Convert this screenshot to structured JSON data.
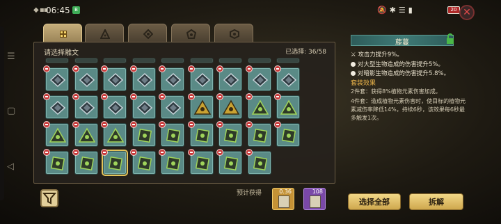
{
  "status_bar": {
    "time": "06:45",
    "app_badge": "B",
    "battery": "20"
  },
  "tabs": [
    {
      "icon": "square-rune-icon"
    },
    {
      "icon": "triangle-rune-icon"
    },
    {
      "icon": "diamond-rune-icon"
    },
    {
      "icon": "pentagon-rune-icon"
    },
    {
      "icon": "hexagon-rune-icon"
    }
  ],
  "panel": {
    "title": "请选择雕文",
    "selected_label": "已选择: 36/58"
  },
  "grid": {
    "rows": [
      [
        "cracked",
        "cracked",
        "cracked",
        "cracked",
        "cracked",
        "cracked",
        "cracked",
        "cracked",
        "cracked"
      ],
      [
        "cracked",
        "cracked",
        "cracked",
        "cracked",
        "cracked",
        "gold-tri",
        "gold-tri",
        "green-tri",
        "green-tri"
      ],
      [
        "green-tri",
        "green-tri",
        "green-tri",
        "green-sq",
        "green-sq",
        "green-sq",
        "green-sq",
        "green-sq",
        "green-sq"
      ],
      [
        "green-sq",
        "green-sq",
        "green-sq",
        "green-sq",
        "green-sq",
        "green-sq",
        "green-sq",
        "green-sq"
      ]
    ],
    "selected_index": [
      3,
      2
    ]
  },
  "rune": {
    "name": "藤蔓",
    "stats": [
      "攻击力提升9%。",
      "对大型生物造成的伤害提升5%。",
      "对暗影生物造成的伤害提升5.8%。"
    ],
    "set_title": "套装效果",
    "set_2": "2件套：获得8%植物元素伤害加成。",
    "set_4": "4件套：造成植物元素伤害时，使目标的植物元素减伤率降低14%，持续6秒，该效果每6秒最多触发1次。"
  },
  "bottom": {
    "expected_label": "预计获得",
    "rewards": [
      {
        "count": "0.36",
        "color": "gold"
      },
      {
        "count": "108",
        "color": "purple"
      }
    ],
    "select_all": "选择全部",
    "decompose": "拆解"
  },
  "colors": {
    "cell": "#5a8a86",
    "accent_gold": "#e9b34a",
    "panel_bg": "#26221c"
  }
}
